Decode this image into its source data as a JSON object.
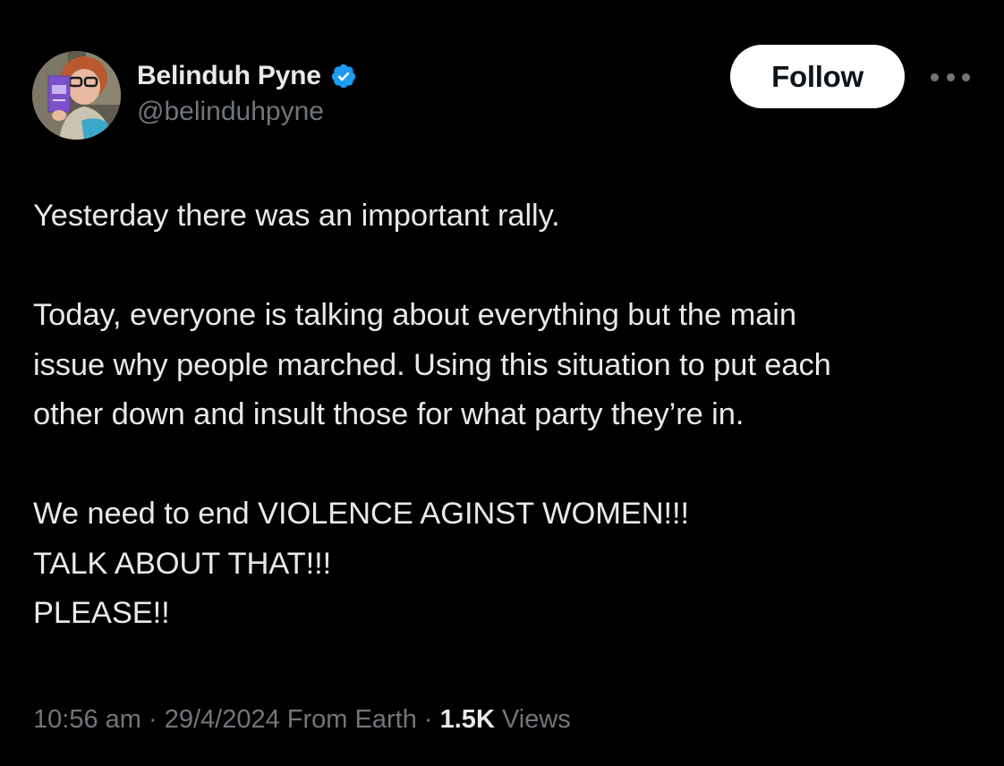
{
  "author": {
    "display_name": "Belinduh Pyne",
    "handle": "@belinduhpyne",
    "verified": true,
    "avatar_icon": "profile-photo",
    "verified_color": "#1d9bf0"
  },
  "actions": {
    "follow_label": "Follow",
    "more_icon": "ellipsis-icon"
  },
  "tweet": {
    "lines": [
      "Yesterday there was an important rally.",
      "",
      "Today, everyone is talking about everything but the main",
      "issue why people marched. Using this situation to put each",
      "other down and insult those for what party they’re in.",
      "",
      "We need to end VIOLENCE AGINST WOMEN!!!",
      "TALK ABOUT THAT!!!",
      "PLEASE!!"
    ]
  },
  "meta": {
    "time": "10:56 am",
    "separator": "·",
    "date": "29/4/2024",
    "source": "From Earth",
    "views_count": "1.5K",
    "views_label": "Views"
  },
  "colors": {
    "background": "#000000",
    "text_primary": "#e7e9ea",
    "text_secondary": "#71767b",
    "follow_bg": "#ffffff",
    "follow_text": "#0f1419"
  }
}
